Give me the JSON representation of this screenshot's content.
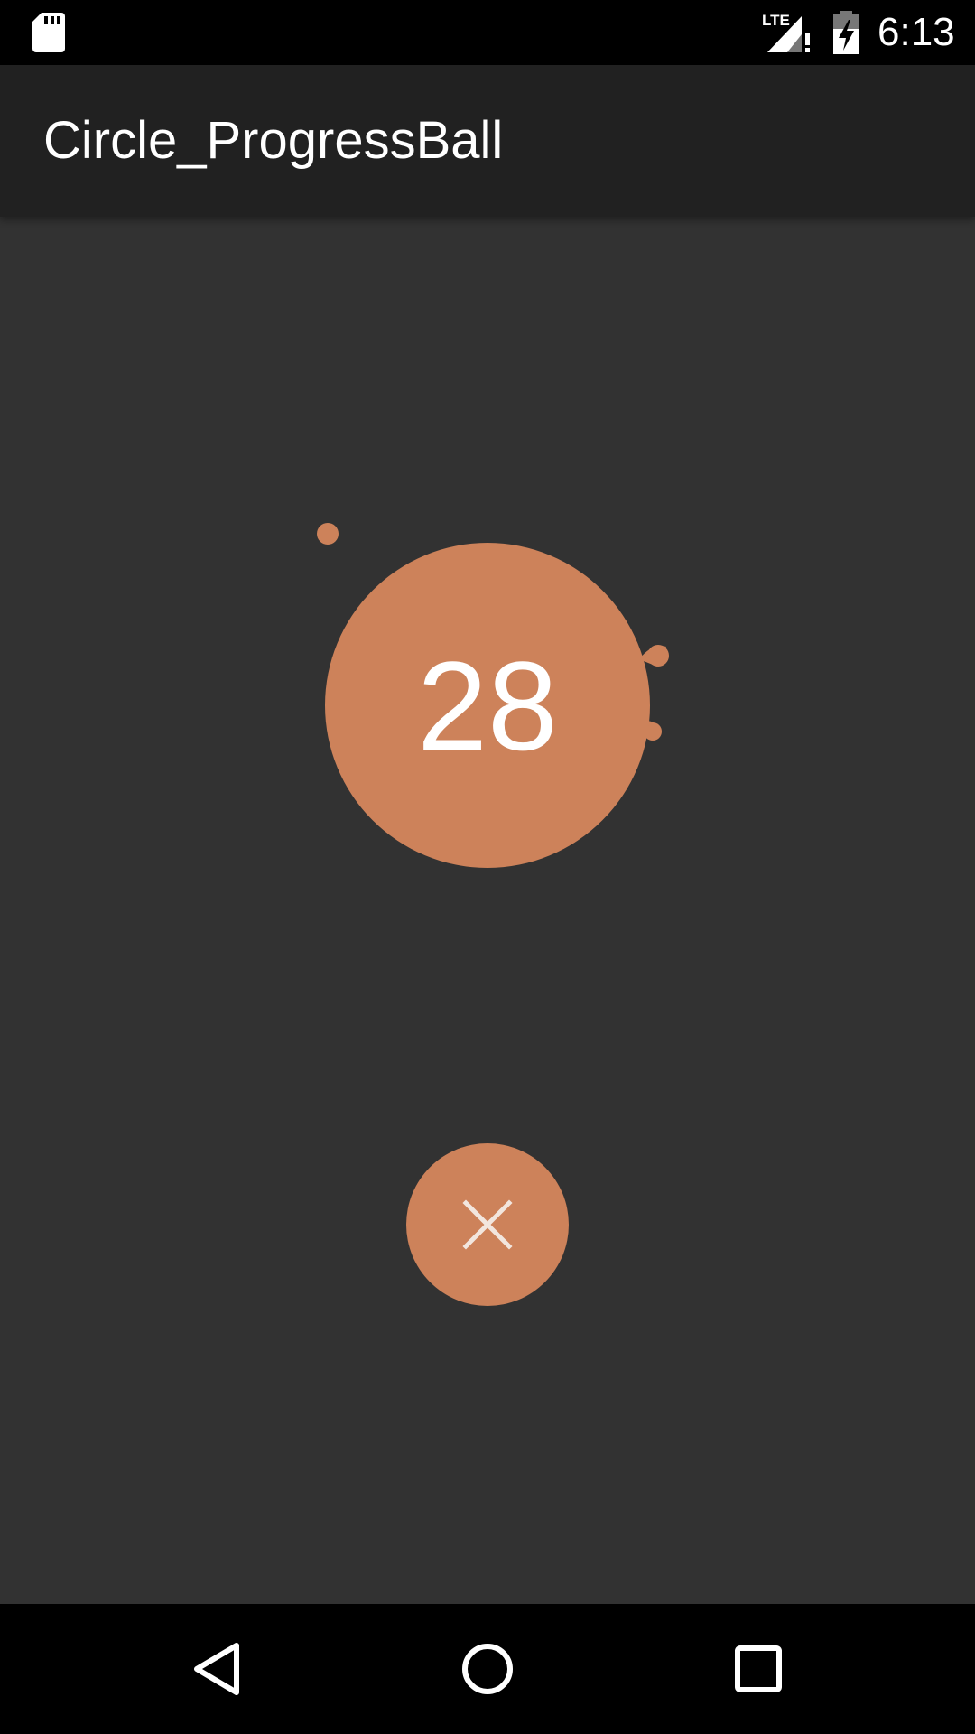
{
  "status_bar": {
    "time": "6:13",
    "network_label": "LTE",
    "icons": [
      "sd-card-icon",
      "signal-icon",
      "battery-charging-icon"
    ]
  },
  "app_bar": {
    "title": "Circle_ProgressBall"
  },
  "progress_ball": {
    "value": "28",
    "color": "#cd825a"
  },
  "cancel_button": {
    "icon": "close-icon",
    "color": "#cd825a"
  },
  "nav_bar": {
    "icons": [
      "back-icon",
      "home-icon",
      "recents-icon"
    ]
  },
  "colors": {
    "background": "#323232",
    "app_bar": "#212121",
    "accent": "#cd825a",
    "system_bars": "#000000"
  }
}
